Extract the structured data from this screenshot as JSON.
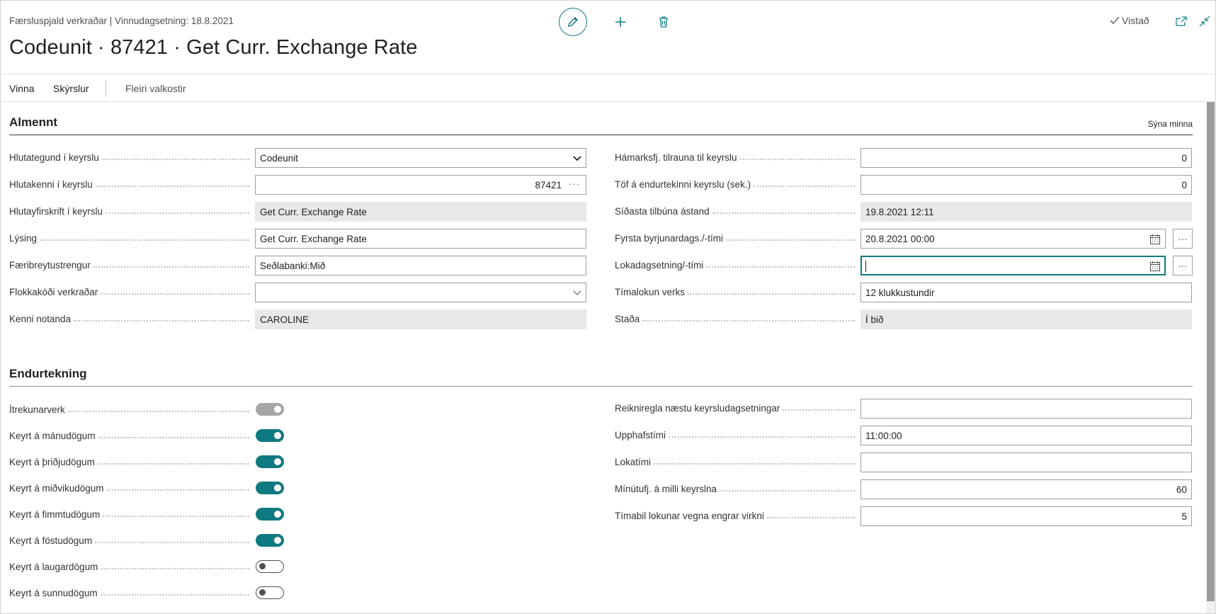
{
  "header": {
    "caption": "Færsluspjald verkraðar | Vinnudagsetning: 18.8.2021",
    "title": "Codeunit · 87421 · Get Curr. Exchange Rate",
    "saved_label": "Vistað"
  },
  "actions": {
    "process": "Vinna",
    "reports": "Skýrslur",
    "more": "Fleiri valkostir"
  },
  "general": {
    "title": "Almennt",
    "show_less": "Sýna minna",
    "left": [
      {
        "label": "Hlutategund í keyrslu",
        "value": "Codeunit"
      },
      {
        "label": "Hlutakenni í keyrslu",
        "value": "87421"
      },
      {
        "label": "Hlutayfirskrift í keyrslu",
        "value": "Get Curr. Exchange Rate"
      },
      {
        "label": "Lýsing",
        "value": "Get Curr. Exchange Rate"
      },
      {
        "label": "Færibreytustrengur",
        "value": "Seðlabanki:Mið"
      },
      {
        "label": "Flokkakóði verkraðar",
        "value": ""
      },
      {
        "label": "Kenni notanda",
        "value": "CAROLINE"
      }
    ],
    "right": [
      {
        "label": "Hámarksfj. tilrauna til keyrslu",
        "value": "0"
      },
      {
        "label": "Töf á endurtekinni keyrslu (sek.)",
        "value": "0"
      },
      {
        "label": "Síðasta tilbúna ástand",
        "value": "19.8.2021 12:11"
      },
      {
        "label": "Fyrsta byrjunardags./-tími",
        "value": "20.8.2021 00:00"
      },
      {
        "label": "Lokadagsetning/-tími",
        "value": ""
      },
      {
        "label": "Tímalokun verks",
        "value": "12 klukkustundir"
      },
      {
        "label": "Staða",
        "value": "Í bið"
      }
    ]
  },
  "recurrence": {
    "title": "Endurtekning",
    "toggles": [
      {
        "label": "Ítrekunarverk",
        "state": "disabled-on"
      },
      {
        "label": "Keyrt á mánudögum",
        "state": "on"
      },
      {
        "label": "Keyrt á þriðjudögum",
        "state": "on"
      },
      {
        "label": "Keyrt á miðvikudögum",
        "state": "on"
      },
      {
        "label": "Keyrt á fimmtudögum",
        "state": "on"
      },
      {
        "label": "Keyrt á föstudögum",
        "state": "on"
      },
      {
        "label": "Keyrt á laugardögum",
        "state": "off"
      },
      {
        "label": "Keyrt á sunnudögum",
        "state": "off"
      }
    ],
    "right": [
      {
        "label": "Reikniregla næstu keyrsludagsetningar",
        "value": ""
      },
      {
        "label": "Upphafstími",
        "value": "11:00:00"
      },
      {
        "label": "Lokatími",
        "value": ""
      },
      {
        "label": "Mínútufj. á milli keyrslna",
        "value": "60"
      },
      {
        "label": "Tímabil lokunar vegna engrar virkni",
        "value": "5"
      }
    ]
  },
  "colors": {
    "accent": "#0f7a80",
    "readonly_bg": "#e8e8e8"
  }
}
